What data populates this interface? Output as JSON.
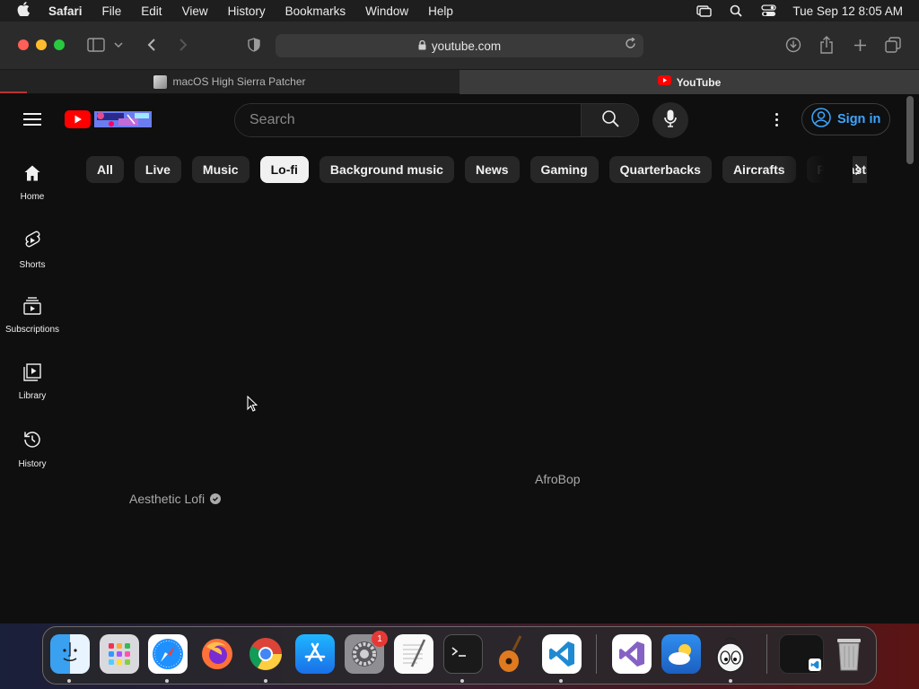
{
  "menubar": {
    "app": "Safari",
    "items": [
      "File",
      "Edit",
      "View",
      "History",
      "Bookmarks",
      "Window",
      "Help"
    ],
    "clock": "Tue Sep 12  8:05 AM"
  },
  "toolbar": {
    "url": "youtube.com"
  },
  "tabs": [
    {
      "title": "macOS High Sierra Patcher"
    },
    {
      "title": "YouTube"
    }
  ],
  "youtube": {
    "search_placeholder": "Search",
    "signin_label": "Sign in",
    "sidebar": [
      {
        "label": "Home",
        "icon": "home-icon"
      },
      {
        "label": "Shorts",
        "icon": "shorts-icon"
      },
      {
        "label": "Subscriptions",
        "icon": "subscriptions-icon"
      },
      {
        "label": "Library",
        "icon": "library-icon"
      },
      {
        "label": "History",
        "icon": "history-icon"
      }
    ],
    "chips": [
      "All",
      "Live",
      "Music",
      "Lo-fi",
      "Background music",
      "News",
      "Gaming",
      "Quarterbacks",
      "Aircrafts",
      "Podcasts"
    ],
    "active_chip": "Lo-fi",
    "channels": {
      "first": "Aesthetic Lofi",
      "second": "AfroBop"
    }
  },
  "dock": {
    "settings_badge": "1",
    "apps": [
      "Finder",
      "Launchpad",
      "Safari",
      "Firefox",
      "Chrome",
      "App Store",
      "System Preferences",
      "TextEdit",
      "Terminal",
      "GarageBand",
      "Visual Studio Code",
      "Visual Studio",
      "Weather",
      "Cyberduck"
    ]
  }
}
